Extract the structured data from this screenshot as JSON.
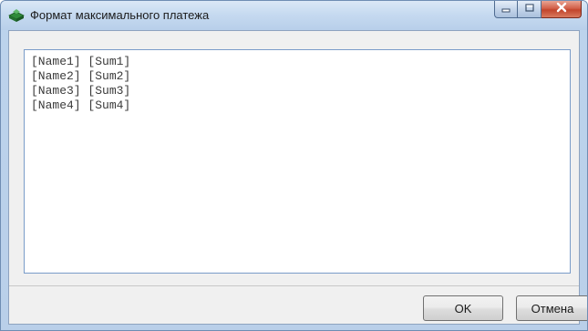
{
  "window": {
    "title": "Формат максимального платежа"
  },
  "icons": {
    "app": "app-icon",
    "minimize": "minimize-icon",
    "maximize": "maximize-icon",
    "close": "close-icon"
  },
  "memo": {
    "lines": [
      "[Name1] [Sum1]",
      "[Name2] [Sum2]",
      "[Name3] [Sum3]",
      "[Name4] [Sum4]"
    ]
  },
  "buttons": {
    "ok_label": "OK",
    "cancel_label": "Отмена"
  },
  "colors": {
    "title_bar": "#c6daf0",
    "close_button": "#c2452c",
    "memo_border": "#7a9cc9"
  }
}
